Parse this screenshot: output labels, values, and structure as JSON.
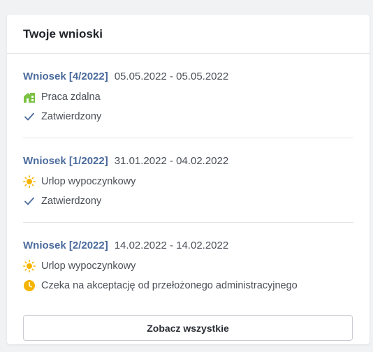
{
  "card": {
    "title": "Twoje wnioski"
  },
  "requests": [
    {
      "id": "Wniosek [4/2022]",
      "dates": "05.05.2022 - 05.05.2022",
      "type": "Praca zdalna",
      "type_icon": "home-office-icon",
      "status": "Zatwierdzony",
      "status_icon": "checkmark-icon"
    },
    {
      "id": "Wniosek [1/2022]",
      "dates": "31.01.2022 - 04.02.2022",
      "type": "Urlop wypoczynkowy",
      "type_icon": "sun-icon",
      "status": "Zatwierdzony",
      "status_icon": "checkmark-icon"
    },
    {
      "id": "Wniosek [2/2022]",
      "dates": "14.02.2022 - 14.02.2022",
      "type": "Urlop wypoczynkowy",
      "type_icon": "sun-icon",
      "status": "Czeka na akceptację od przełożonego administracyjnego",
      "status_icon": "clock-icon"
    }
  ],
  "actions": {
    "see_all_label": "Zobacz wszystkie"
  },
  "colors": {
    "link": "#4a6a9c",
    "approved_check": "#4a6a9c",
    "home_office_green": "#7bc142",
    "sun_yellow": "#f5b400",
    "pending_orange": "#f5b400"
  }
}
